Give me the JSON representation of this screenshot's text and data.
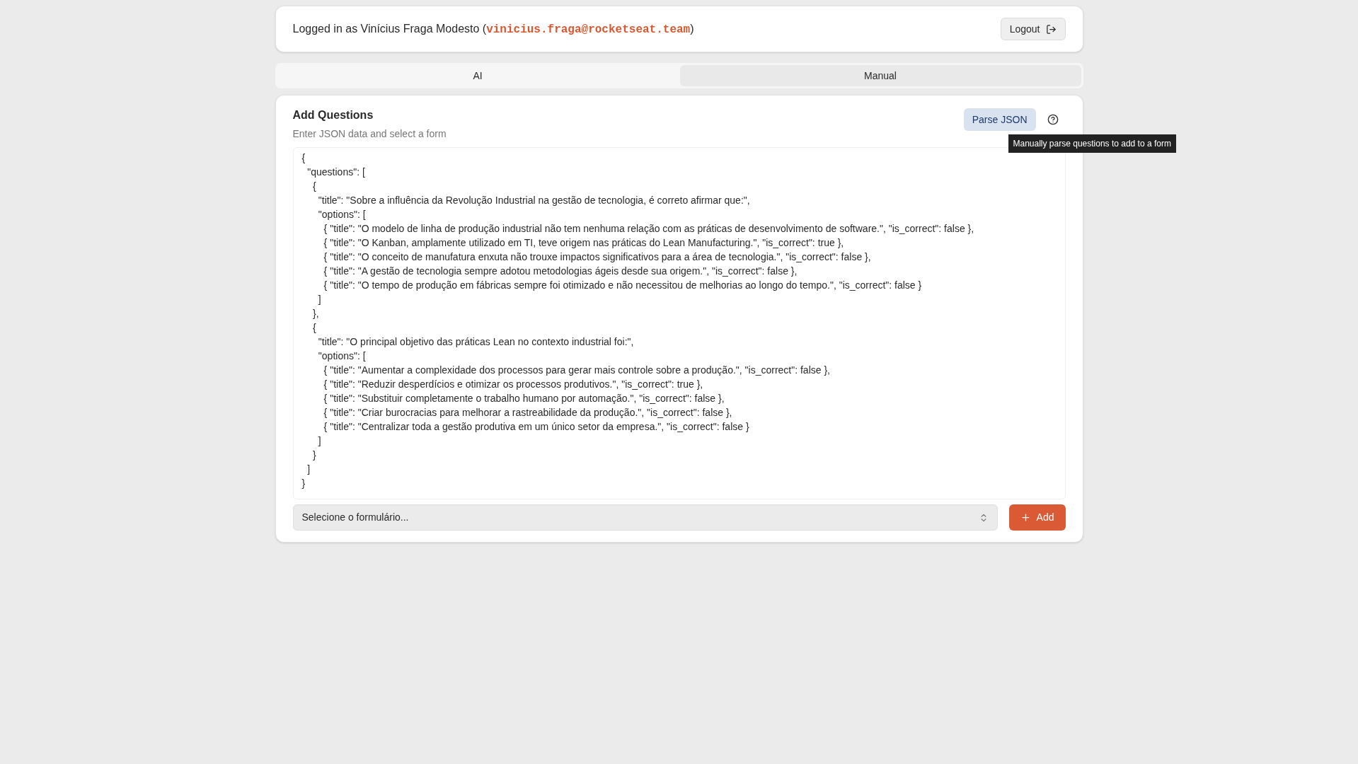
{
  "session": {
    "prefix": "Logged in as Vinícius Fraga Modesto (",
    "email": "vinicius.fraga@rocketseat.team",
    "suffix": ")",
    "logout_button": "Logout"
  },
  "tabs": [
    {
      "label": "AI",
      "selected": false
    },
    {
      "label": "Manual",
      "selected": true
    }
  ],
  "card": {
    "title": "Add Questions",
    "subtitle": "Enter JSON data and select a form",
    "parse_button": "Parse JSON",
    "tooltip": "Manually parse questions to add to a form",
    "json_value": "{\n  \"questions\": [\n    {\n      \"title\": \"Sobre a influência da Revolução Industrial na gestão de tecnologia, é correto afirmar que:\",\n      \"options\": [\n        { \"title\": \"O modelo de linha de produção industrial não tem nenhuma relação com as práticas de desenvolvimento de software.\", \"is_correct\": false },\n        { \"title\": \"O Kanban, amplamente utilizado em TI, teve origem nas práticas do Lean Manufacturing.\", \"is_correct\": true },\n        { \"title\": \"O conceito de manufatura enxuta não trouxe impactos significativos para a área de tecnologia.\", \"is_correct\": false },\n        { \"title\": \"A gestão de tecnologia sempre adotou metodologias ágeis desde sua origem.\", \"is_correct\": false },\n        { \"title\": \"O tempo de produção em fábricas sempre foi otimizado e não necessitou de melhorias ao longo do tempo.\", \"is_correct\": false }\n      ]\n    },\n    {\n      \"title\": \"O principal objetivo das práticas Lean no contexto industrial foi:\",\n      \"options\": [\n        { \"title\": \"Aumentar a complexidade dos processos para gerar mais controle sobre a produção.\", \"is_correct\": false },\n        { \"title\": \"Reduzir desperdícios e otimizar os processos produtivos.\", \"is_correct\": true },\n        { \"title\": \"Substituir completamente o trabalho humano por automação.\", \"is_correct\": false },\n        { \"title\": \"Criar burocracias para melhorar a rastreabilidade da produção.\", \"is_correct\": false },\n        { \"title\": \"Centralizar toda a gestão produtiva em um único setor da empresa.\", \"is_correct\": false }\n      ]\n    }\n  ]\n}",
    "form_select": {
      "value": "Selecione o formulário..."
    },
    "add_button": "Add"
  }
}
